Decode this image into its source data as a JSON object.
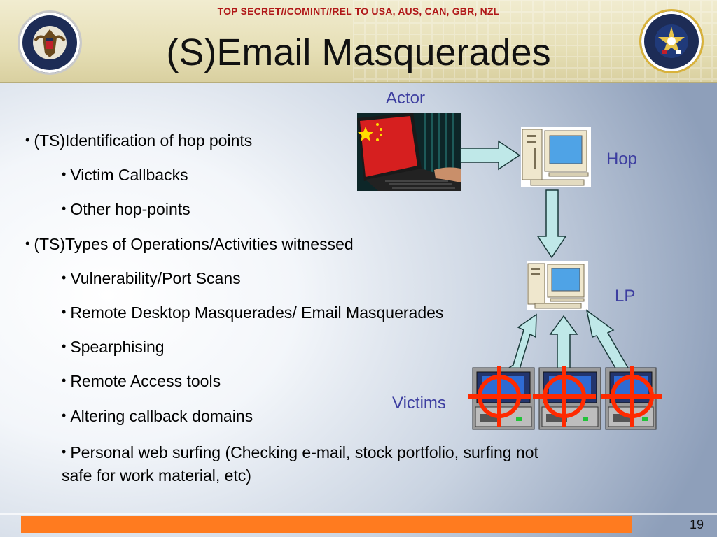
{
  "classification": "TOP SECRET//COMINT//REL TO USA, AUS, CAN, GBR, NZL",
  "title": "(S)Email Masquerades",
  "seals": {
    "left": {
      "icon": "nsa-seal",
      "text": "NATIONAL SECURITY AGENCY · UNITED STATES OF AMERICA"
    },
    "right": {
      "icon": "css-seal",
      "text": "CENTRAL SECURITY SERVICE · UNITED STATES OF AMERICA"
    }
  },
  "bullets": [
    {
      "level": 1,
      "text": "(TS)Identification of hop points"
    },
    {
      "level": 2,
      "text": "Victim Callbacks"
    },
    {
      "level": 2,
      "text": "Other hop-points"
    },
    {
      "level": 1,
      "text": "(TS)Types of Operations/Activities witnessed"
    },
    {
      "level": 2,
      "text": "Vulnerability/Port Scans"
    },
    {
      "level": 2,
      "text": "Remote Desktop Masquerades/ Email Masquerades"
    },
    {
      "level": 2,
      "text": "Spearphising"
    },
    {
      "level": 2,
      "text": "Remote Access tools"
    },
    {
      "level": 2,
      "text": "Altering callback domains"
    },
    {
      "level": 2,
      "text": "Personal web surfing (Checking e-mail, stock portfolio, surfing not safe for work material, etc)"
    }
  ],
  "diagram": {
    "actor_label": "Actor",
    "hop_label": "Hop",
    "lp_label": "LP",
    "victims_label": "Victims",
    "colors": {
      "arrow_fill": "#bfe8e8",
      "arrow_stroke": "#1a3a3a",
      "target": "#ff2a00",
      "label": "#3d3ea0"
    }
  },
  "page_number": "19",
  "colors": {
    "footer_bar": "#ff7b1f",
    "classification": "#b01818"
  }
}
